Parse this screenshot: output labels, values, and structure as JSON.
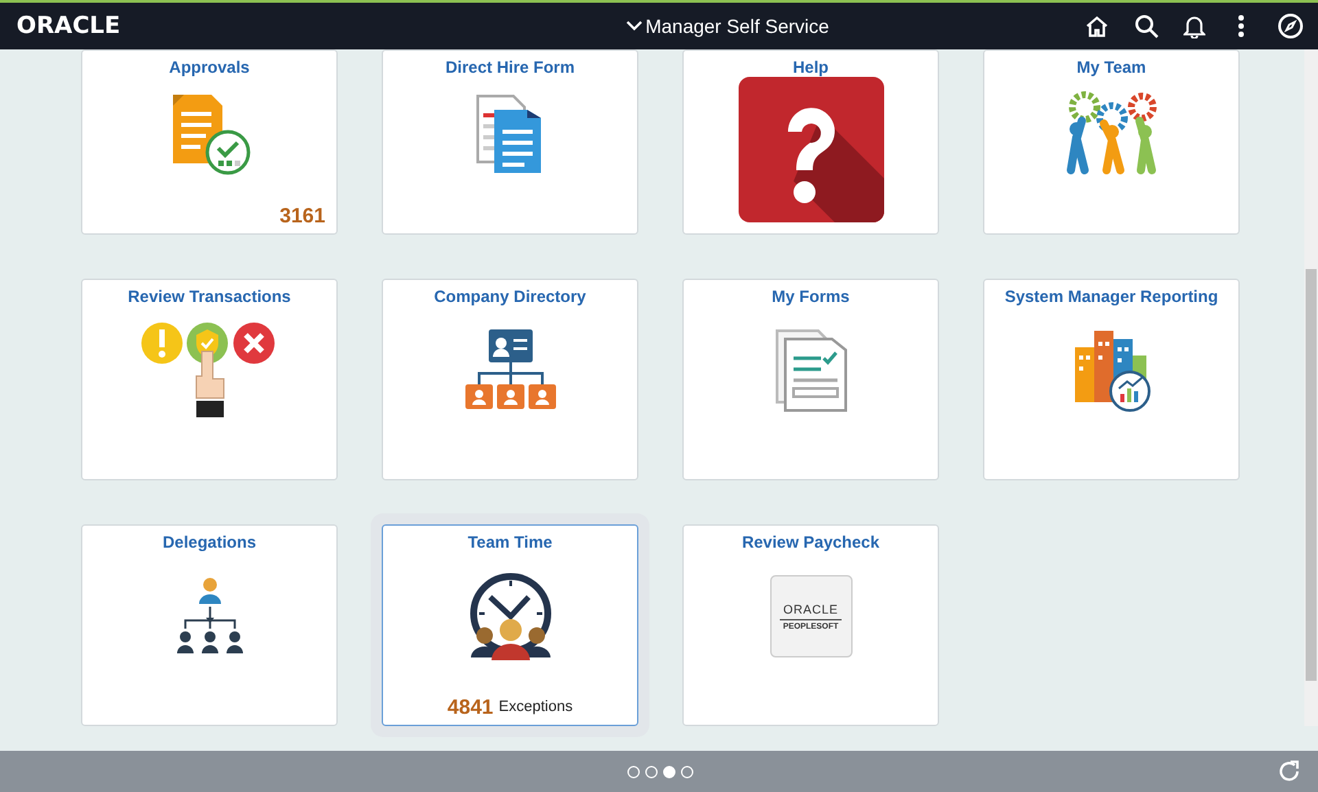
{
  "header": {
    "logo": "ORACLE",
    "title": "Manager Self Service"
  },
  "tiles": [
    {
      "title": "Approvals",
      "kind": "approvals",
      "badge": "3161",
      "selected": false
    },
    {
      "title": "Direct Hire Form",
      "kind": "document",
      "selected": false
    },
    {
      "title": "Help",
      "kind": "help",
      "selected": false
    },
    {
      "title": "My Team",
      "kind": "team",
      "selected": false
    },
    {
      "title": "Review Transactions",
      "kind": "review",
      "selected": false
    },
    {
      "title": "Company Directory",
      "kind": "directory",
      "selected": false
    },
    {
      "title": "My Forms",
      "kind": "forms",
      "selected": false
    },
    {
      "title": "System Manager Reporting",
      "kind": "reporting",
      "selected": false
    },
    {
      "title": "Delegations",
      "kind": "delegations",
      "selected": false
    },
    {
      "title": "Team Time",
      "kind": "clock",
      "badge": "4841",
      "badge_label": "Exceptions",
      "selected": true
    },
    {
      "title": "Review Paycheck",
      "kind": "logo",
      "logo_lines": [
        "ORACLE",
        "PEOPLESOFT"
      ],
      "selected": false
    }
  ],
  "pager": [
    {
      "selected": false
    },
    {
      "selected": false
    },
    {
      "selected": true
    },
    {
      "selected": false
    }
  ]
}
